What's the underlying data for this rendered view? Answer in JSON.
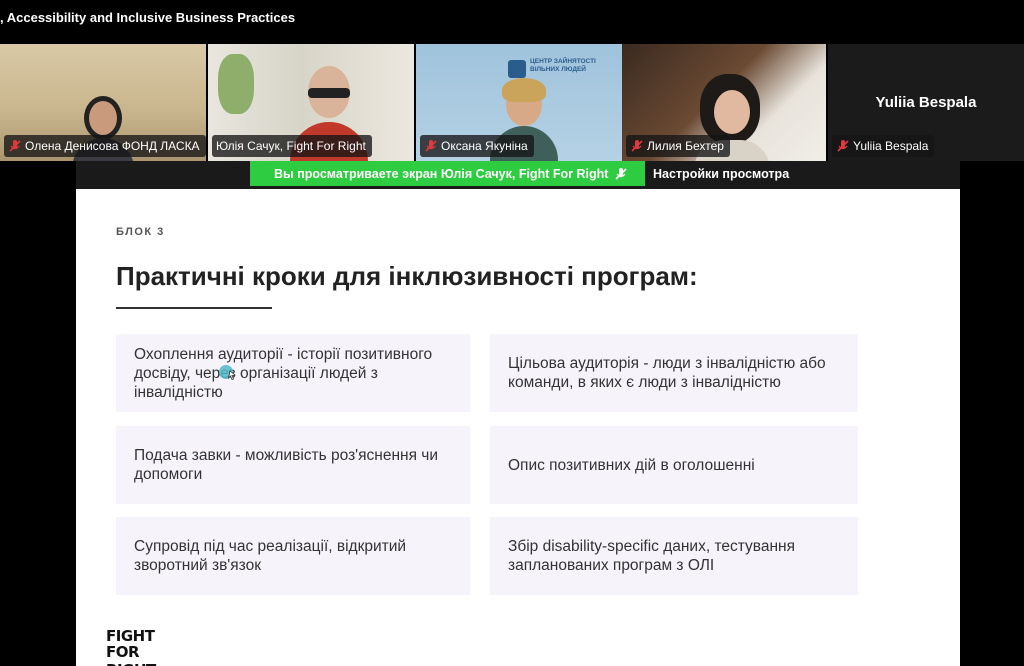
{
  "meeting": {
    "title": ", Accessibility and Inclusive Business Practices"
  },
  "participants": [
    {
      "name": "Олена Денисова ФОНД ЛАСКА",
      "muted": true
    },
    {
      "name": "Юлія Сачук, Fight For Right",
      "muted": false,
      "active_speaker": true
    },
    {
      "name": "Оксана Якуніна",
      "muted": true,
      "background_text": "ЦЕНТР ЗАЙНЯТОСТІ ВІЛЬНИХ ЛЮДЕЙ"
    },
    {
      "name": "Лилия Бехтер",
      "muted": true
    },
    {
      "name": "Yuliia Bespala",
      "muted": true,
      "display_name": "Yuliia Bespala"
    }
  ],
  "share": {
    "banner_text": "Вы просматриваете экран  Юлія Сачук, Fight For Right",
    "view_options": "Настройки просмотра"
  },
  "slide": {
    "block_label": "БЛОК 3",
    "title": "Практичні кроки для інклюзивності програм:",
    "cards": [
      "Охоплення аудиторії - історії позитивного досвіду, через організації людей з інвалідністю",
      "Цільова аудиторія - люди з інвалідністю або команди, в яких є люди з інвалідністю",
      "Подача завки - можливість роз'яснення чи допомоги",
      "Опис позитивних дій в оголошенні",
      "Супровід під час реалізації, відкритий зворотний зв'язок",
      "Збір disability-specific даних, тестування запланованих програм з ОЛІ"
    ],
    "logo_line1": "FIGHT",
    "logo_line2": "FOR RIGHT"
  },
  "colors": {
    "share_green": "#2ecc40",
    "active_outline": "#3fb950",
    "card_bg": "#f6f4fa",
    "mute_red": "#e0393e"
  }
}
